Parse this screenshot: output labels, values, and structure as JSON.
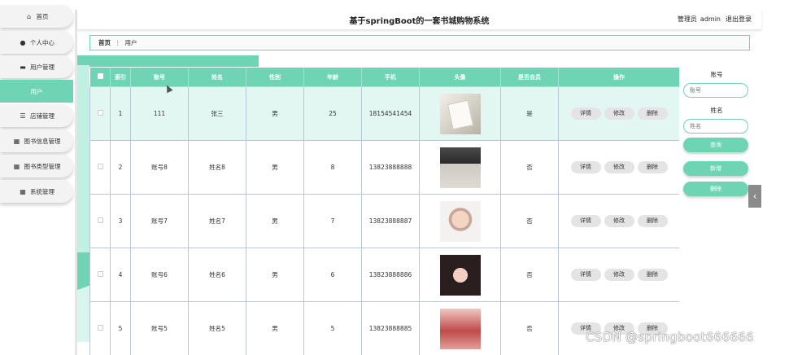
{
  "header": {
    "title": "基于springBoot的一套书城购物系统",
    "role": "管理员",
    "username": "admin",
    "logout": "退出登录"
  },
  "sidebar": {
    "items": [
      {
        "label": "首页",
        "icon": "home-icon",
        "glyph": "⌂",
        "active": false
      },
      {
        "label": "个人中心",
        "icon": "person-icon",
        "glyph": "●",
        "active": false
      },
      {
        "label": "用户管理",
        "icon": "users-icon",
        "glyph": "▬",
        "active": false
      },
      {
        "label": "用户",
        "icon": "",
        "glyph": "",
        "active": true
      },
      {
        "label": "店铺管理",
        "icon": "list-icon",
        "glyph": "☰",
        "active": false
      },
      {
        "label": "图书信息管理",
        "icon": "grid-icon",
        "glyph": "▦",
        "active": false
      },
      {
        "label": "图书类型管理",
        "icon": "grid-icon",
        "glyph": "▦",
        "active": false
      },
      {
        "label": "系统管理",
        "icon": "table-icon",
        "glyph": "▦",
        "active": false
      }
    ]
  },
  "breadcrumb": {
    "home": "首页",
    "separator": "⋮",
    "current": "用户"
  },
  "table": {
    "columns": [
      "索引",
      "账号",
      "姓名",
      "性别",
      "年龄",
      "手机",
      "头像",
      "是否会员",
      "操作"
    ],
    "rows": [
      {
        "index": "1",
        "account": "111",
        "name": "张三",
        "gender": "男",
        "age": "25",
        "phone": "18154541454",
        "avatar": "av1",
        "member": "是"
      },
      {
        "index": "2",
        "account": "账号8",
        "name": "姓名8",
        "gender": "男",
        "age": "8",
        "phone": "13823888888",
        "avatar": "av2",
        "member": "否"
      },
      {
        "index": "3",
        "account": "账号7",
        "name": "姓名7",
        "gender": "男",
        "age": "7",
        "phone": "13823888887",
        "avatar": "av3",
        "member": "否"
      },
      {
        "index": "4",
        "account": "账号6",
        "name": "姓名6",
        "gender": "男",
        "age": "6",
        "phone": "13823888886",
        "avatar": "av4",
        "member": "否"
      },
      {
        "index": "5",
        "account": "账号5",
        "name": "姓名5",
        "gender": "男",
        "age": "5",
        "phone": "13823888885",
        "avatar": "av5",
        "member": "否"
      }
    ],
    "actions": {
      "detail": "详情",
      "edit": "修改",
      "delete": "删除"
    }
  },
  "filter": {
    "account_label": "账号",
    "account_placeholder": "账号",
    "name_label": "姓名",
    "name_placeholder": "姓名",
    "search_btn": "查询",
    "add_btn": "新增",
    "delete_btn": "删除"
  },
  "edge_tab": "‹",
  "watermark": "CSDN @springboot666666",
  "colors": {
    "accent": "#6fd4b4",
    "accent_light": "#e2f7f1",
    "button_gray": "#e4e4e4"
  }
}
